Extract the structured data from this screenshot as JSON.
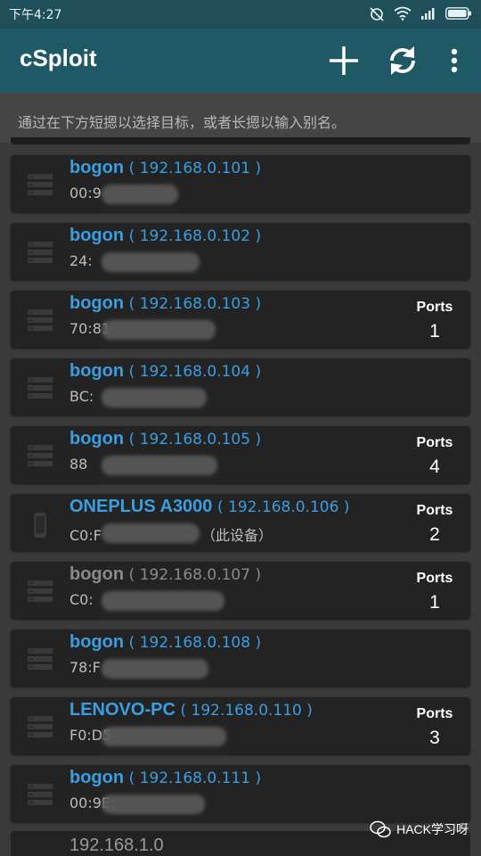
{
  "status_bar": {
    "time": "下午4:27",
    "icons": [
      "alarm-off-icon",
      "wifi-icon",
      "signal-icon",
      "battery-icon"
    ]
  },
  "app_bar": {
    "title": "cSploit",
    "actions": [
      "add-icon",
      "refresh-icon",
      "overflow-menu-icon"
    ]
  },
  "hint": "通过在下方短摁以选择目标，或者长摁以输入别名。",
  "colors": {
    "accent": "#3a9ee0",
    "app_bar": "#1f5965",
    "card": "#232323",
    "background": "#3a3a3a"
  },
  "hosts": [
    {
      "name": "bogon",
      "ip": "( 192.168.0.101 )",
      "mac": "00:9",
      "ports_label": "",
      "ports": "",
      "state": "active",
      "icon": "server-icon"
    },
    {
      "name": "bogon",
      "ip": "( 192.168.0.102 )",
      "mac": "24:",
      "ports_label": "",
      "ports": "",
      "state": "active",
      "icon": "server-icon"
    },
    {
      "name": "bogon",
      "ip": "( 192.168.0.103 )",
      "mac": "70:81",
      "ports_label": "Ports",
      "ports": "1",
      "state": "active",
      "icon": "server-icon"
    },
    {
      "name": "bogon",
      "ip": "( 192.168.0.104 )",
      "mac": "BC:",
      "ports_label": "",
      "ports": "",
      "state": "active",
      "icon": "server-icon"
    },
    {
      "name": "bogon",
      "ip": "( 192.168.0.105 )",
      "mac": "88",
      "ports_label": "Ports",
      "ports": "4",
      "state": "active",
      "icon": "server-icon"
    },
    {
      "name": "ONEPLUS A3000",
      "ip": "( 192.168.0.106 )",
      "mac": "C0:F",
      "suffix": "（此设备）",
      "ports_label": "Ports",
      "ports": "2",
      "state": "active",
      "icon": "phone-icon"
    },
    {
      "name": "bogon",
      "ip": "( 192.168.0.107 )",
      "mac": "C0:",
      "ports_label": "Ports",
      "ports": "1",
      "state": "dim",
      "icon": "server-icon"
    },
    {
      "name": "bogon",
      "ip": "( 192.168.0.108 )",
      "mac": "78:F",
      "ports_label": "",
      "ports": "",
      "state": "active",
      "icon": "server-icon"
    },
    {
      "name": "LENOVO-PC",
      "ip": "( 192.168.0.110 )",
      "mac": "F0:D5",
      "ports_label": "Ports",
      "ports": "3",
      "state": "active",
      "icon": "server-icon"
    },
    {
      "name": "bogon",
      "ip": "( 192.168.0.111 )",
      "mac": "00:9E:",
      "ports_label": "",
      "ports": "",
      "state": "active",
      "icon": "server-icon"
    }
  ],
  "bottom_peek": "192.168.1.0",
  "watermark": "HACK学习呀"
}
